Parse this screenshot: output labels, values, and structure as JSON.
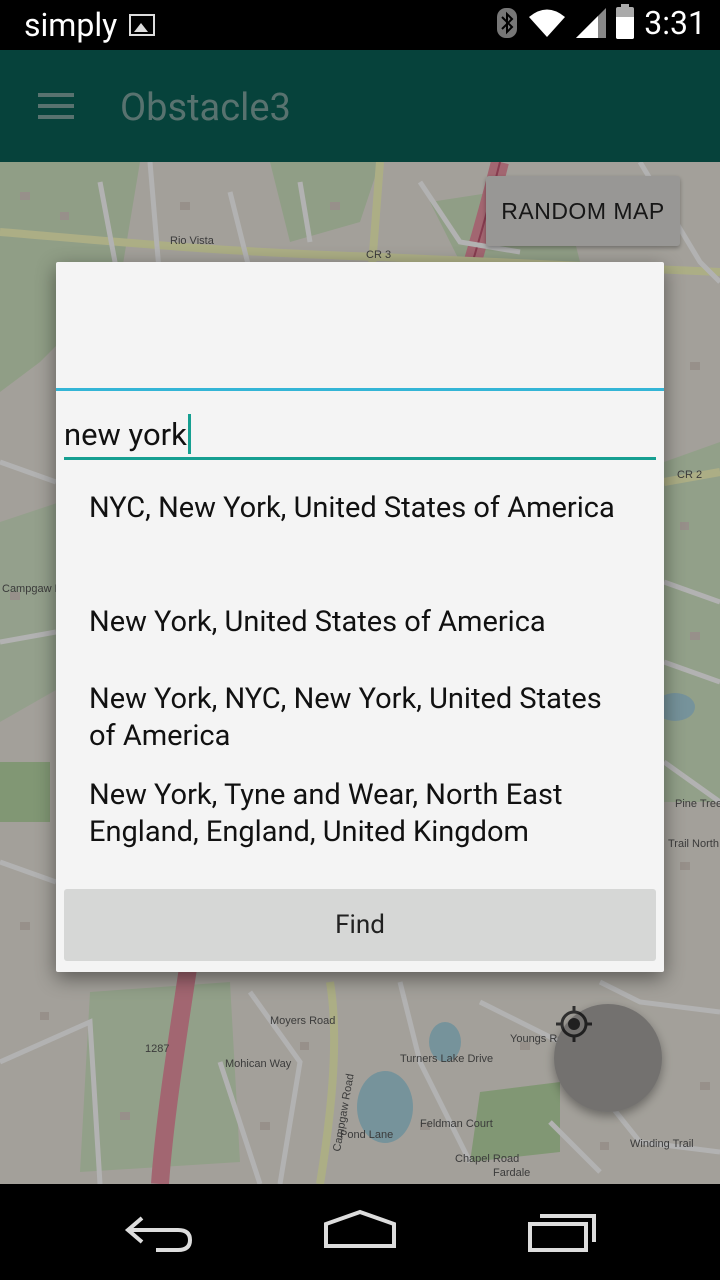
{
  "status_bar": {
    "carrier": "simply",
    "time": "3:31",
    "icons": [
      "image-notification-icon",
      "bluetooth-icon",
      "wifi-icon",
      "signal-icon",
      "battery-icon"
    ]
  },
  "app_bar": {
    "title": "Obstacle3",
    "menu_icon": "hamburger-menu-icon"
  },
  "map": {
    "random_map_label": "RANDOM MAP",
    "locate_icon": "my-location-icon",
    "labels": [
      "Rio Vista",
      "CR 3",
      "CR 2",
      "Campgaw Road",
      "Campgaw Mountain Ski Area",
      "Fardale",
      "1287",
      "Pond Lane",
      "Pine Tree Road",
      "Trail North",
      "Winding Trail",
      "Youngs Road",
      "Turners Lake Drive",
      "Mohican Way",
      "Moyers Road",
      "Chapel Road",
      "Feldman Court"
    ]
  },
  "dialog": {
    "search_value": "new york",
    "suggestions": [
      "NYC, New York, United States of America",
      "New York, United States of America",
      "New York, NYC, New York, United States of America",
      "New York, Tyne and Wear, North East England, England, United Kingdom"
    ],
    "find_label": "Find"
  },
  "nav_bar": {
    "back_icon": "back-icon",
    "home_icon": "home-icon",
    "recents_icon": "recents-icon"
  },
  "colors": {
    "app_bar": "#0a6b60",
    "accent": "#169f91",
    "dialog_divider": "#33b5d6",
    "dialog_bg": "#f4f4f4"
  }
}
